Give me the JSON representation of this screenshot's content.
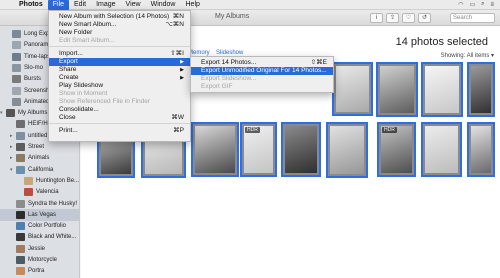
{
  "menubar": {
    "items": [
      {
        "label": "Photos",
        "bold": true
      },
      {
        "label": "File",
        "active": true
      },
      {
        "label": "Edit"
      },
      {
        "label": "Image"
      },
      {
        "label": "View"
      },
      {
        "label": "Window"
      },
      {
        "label": "Help"
      }
    ]
  },
  "toolbar": {
    "title": "My Albums",
    "search_placeholder": "Search"
  },
  "file_menu": {
    "items": [
      {
        "label": "New Album with Selection (14 Photos)",
        "shortcut": "⌘N"
      },
      {
        "label": "New Smart Album...",
        "shortcut": "⌥⌘N"
      },
      {
        "label": "New Folder"
      },
      {
        "label": "Edit Smart Album...",
        "disabled": true
      },
      {
        "label": "Import...",
        "shortcut": "⇧⌘I"
      },
      {
        "label": "Export",
        "highlight": true,
        "submenu": true
      },
      {
        "label": "Share",
        "submenu": true
      },
      {
        "label": "Create",
        "submenu": true
      },
      {
        "label": "Play Slideshow"
      },
      {
        "label": "Show in Moment",
        "disabled": true
      },
      {
        "label": "Show Referenced File in Finder",
        "disabled": true
      },
      {
        "label": "Consolidate..."
      },
      {
        "label": "Close",
        "shortcut": "⌘W"
      },
      {
        "label": "Print...",
        "shortcut": "⌘P"
      }
    ]
  },
  "export_menu": {
    "items": [
      {
        "label": "Export 14 Photos...",
        "shortcut": "⇧⌘E"
      },
      {
        "label": "Export Unmodified Original For 14 Photos...",
        "highlight": true
      },
      {
        "label": "Export Slideshow...",
        "disabled": true
      },
      {
        "label": "Export GIF",
        "disabled": true
      }
    ]
  },
  "sidebar": {
    "items": [
      {
        "label": "Long Exposure",
        "color": "#7d8a96"
      },
      {
        "label": "Panoramas",
        "color": "#9aa7b3"
      },
      {
        "label": "Time-lapse",
        "color": "#6f7c8a"
      },
      {
        "label": "Slo-mo",
        "color": "#8b96a1"
      },
      {
        "label": "Bursts",
        "color": "#7a7a7a"
      },
      {
        "label": "Screenshots",
        "color": "#a0a7ae"
      },
      {
        "label": "Animated",
        "color": "#848c94"
      },
      {
        "label": "My Albums",
        "color": "#555555"
      },
      {
        "label": "HEIF/HEVC",
        "color": "#6d6d6d"
      },
      {
        "label": "untitled folder",
        "color": "#7e8fa4"
      },
      {
        "label": "Street",
        "color": "#5d5d5d"
      },
      {
        "label": "Animals",
        "color": "#8a7b64"
      },
      {
        "label": "California",
        "color": "#6c8fae"
      },
      {
        "label": "Huntington Be...",
        "color": "#c7a677"
      },
      {
        "label": "Valencia",
        "color": "#b7503e"
      },
      {
        "label": "Syndra the Husky!",
        "color": "#8c8c8c"
      },
      {
        "label": "Las Vegas",
        "color": "#2c2c2c",
        "selected": true
      },
      {
        "label": "Color Portfolio",
        "color": "#4d7fb0"
      },
      {
        "label": "Black and White...",
        "color": "#3a3a3a"
      },
      {
        "label": "Jessie",
        "color": "#a07c62"
      },
      {
        "label": "Motorcycle",
        "color": "#4f5a63"
      },
      {
        "label": "Portra",
        "color": "#c78a5d"
      }
    ]
  },
  "main": {
    "selected_count": "14 photos selected",
    "showing": "Showing: All items ▾",
    "crumbs": [
      "Memory",
      "Slideshow"
    ],
    "hdr_label": "HDR"
  }
}
